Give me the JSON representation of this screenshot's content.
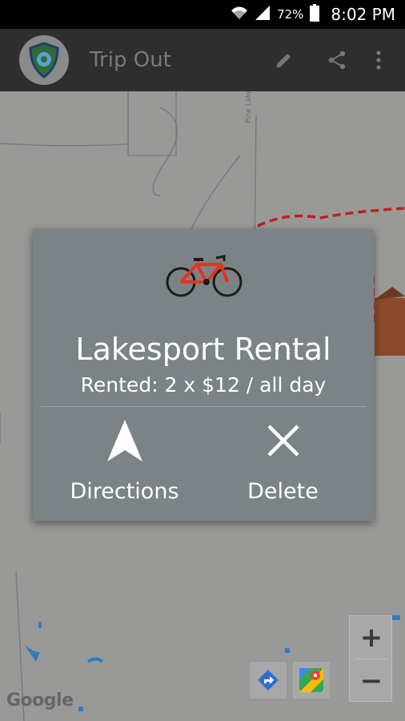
{
  "status_bar": {
    "battery_percent": "72%",
    "time": "8:02 PM",
    "icons": [
      "wifi-icon",
      "signal-icon",
      "battery-icon"
    ]
  },
  "app_bar": {
    "title": "Trip Out",
    "logo_icon": "shield-logo-icon",
    "actions": [
      "edit-icon",
      "share-icon",
      "overflow-menu-icon"
    ]
  },
  "map": {
    "road_label": "Pine Lake Rd",
    "attribution": "Google",
    "zoom_in_label": "+",
    "zoom_out_label": "−",
    "tools": [
      "directions-icon",
      "google-maps-icon"
    ]
  },
  "dialog": {
    "icon": "bicycle-icon",
    "title": "Lakesport Rental",
    "subtitle": "Rented: 2 x $12 / all day",
    "actions": [
      {
        "icon": "navigation-arrow-icon",
        "label": "Directions"
      },
      {
        "icon": "close-icon",
        "label": "Delete"
      }
    ]
  },
  "colors": {
    "app_bar": "#2e2e2e",
    "dialog_background": "#7b8386",
    "route": "#c0201e",
    "bike_frame": "#e8321e"
  }
}
